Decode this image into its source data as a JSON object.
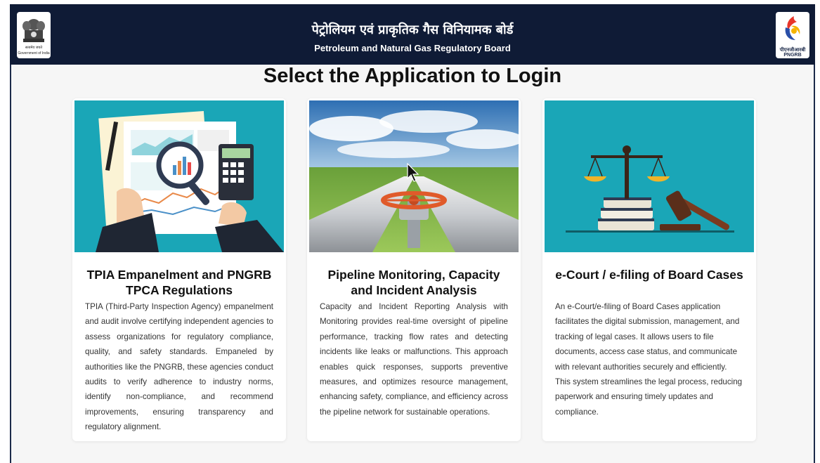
{
  "header": {
    "hindi_title": "पेट्रोलियम एवं प्राकृतिक गैस विनियामक बोर्ड",
    "english_title": "Petroleum and Natural Gas Regulatory Board",
    "emblem_caption_1": "सत्यमेव जयते",
    "emblem_caption_2": "Government of India",
    "logo_hindi": "पीएनजीआरबी",
    "logo_english": "PNGRB"
  },
  "page_heading": "Select the Application to Login",
  "cards": [
    {
      "title": "TPIA Empanelment and PNGRB TPCA Regulations",
      "description": "TPIA (Third-Party Inspection Agency) empanelment and audit involve certifying independent agencies to assess organizations for regulatory compliance, quality, and safety standards. Empaneled by authorities like the PNGRB, these agencies conduct audits to verify adherence to industry norms, identify non-compliance, and recommend improvements, ensuring transparency and regulatory alignment.",
      "image": "audit-documents-magnifier-illustration"
    },
    {
      "title": "Pipeline Monitoring, Capacity and Incident Analysis",
      "description": "Capacity and Incident Reporting Analysis with Monitoring provides real-time oversight of pipeline performance, tracking flow rates and detecting incidents like leaks or malfunctions. This approach enables quick responses, supports preventive measures, and optimizes resource management, enhancing safety, compliance, and efficiency across the pipeline network for sustainable operations.",
      "image": "pipeline-valve-photo"
    },
    {
      "title": "e-Court / e-filing of Board Cases",
      "description": "An e-Court/e-filing of Board Cases application facilitates the digital submission, management, and tracking of legal cases. It allows users to file documents, access case status, and communicate with relevant authorities securely and efficiently. This system streamlines the legal process, reducing paperwork and ensuring timely updates and compliance.",
      "image": "scales-of-justice-gavel-illustration"
    }
  ],
  "colors": {
    "header_bg": "#0f1b36",
    "teal": "#1aa6b7",
    "page_bg": "#f6f6f6"
  }
}
